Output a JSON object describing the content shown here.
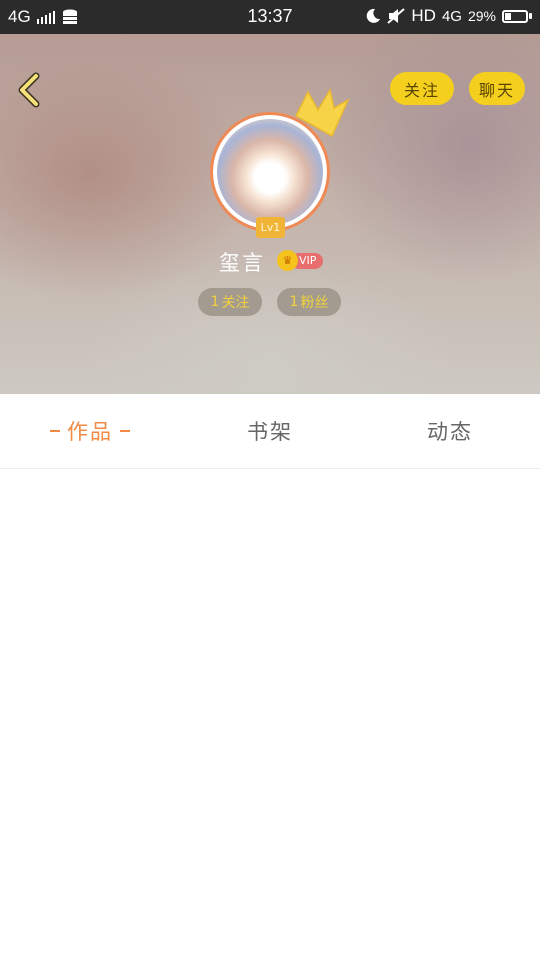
{
  "status_bar": {
    "network": "4G",
    "time": "13:37",
    "hd_label": "HD",
    "network_right": "4G",
    "battery_percent": "29%",
    "battery_level": 0.29,
    "icons": [
      "signal-icon",
      "database-icon",
      "moon-icon",
      "mute-icon",
      "battery-icon"
    ]
  },
  "header": {
    "back_icon": "chevron-left-icon",
    "follow_label": "关注",
    "chat_label": "聊天",
    "level_label": "Lv1",
    "username": "玺言",
    "vip_label": "VIP",
    "following_count": "1",
    "following_label": "关注",
    "fans_count": "1",
    "fans_label": "粉丝",
    "accent_color": "#f5cf1d"
  },
  "tabs": [
    {
      "label": "作品",
      "active": true
    },
    {
      "label": "书架",
      "active": false
    },
    {
      "label": "动态",
      "active": false
    }
  ],
  "colors": {
    "active_tab": "#f08a44",
    "inactive_tab": "#666666",
    "avatar_border": "#f08a55",
    "status_bar_bg": "#2b2b2b"
  }
}
